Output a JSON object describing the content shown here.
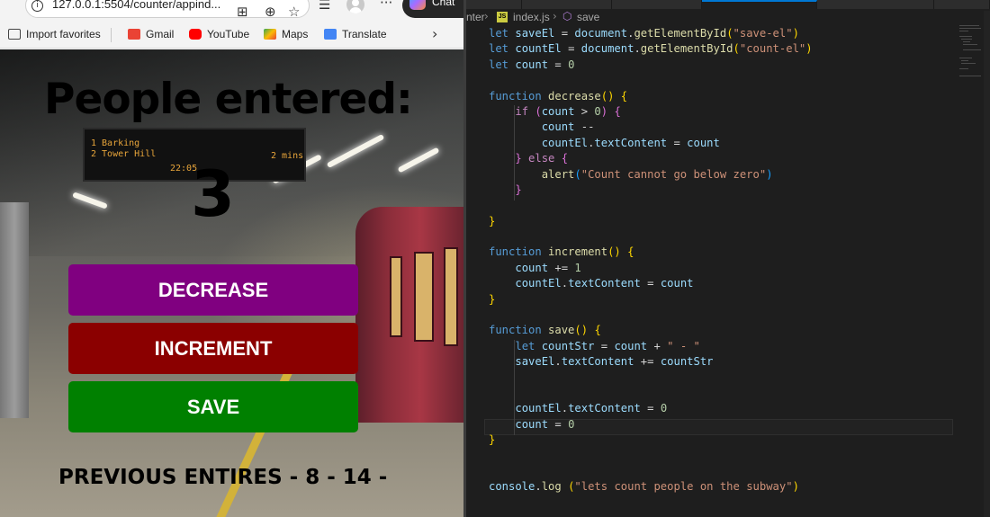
{
  "browser": {
    "url": "127.0.0.1:5504/counter/appind...",
    "copilot_label": "Chat",
    "favorites": [
      {
        "label": "Import favorites",
        "icon": "import-favorites-icon",
        "color": "#444444"
      },
      {
        "label": "Gmail",
        "icon": "gmail-icon",
        "color": "#ea4335"
      },
      {
        "label": "YouTube",
        "icon": "youtube-icon",
        "color": "#ff0000"
      },
      {
        "label": "Maps",
        "icon": "maps-icon",
        "color": "#34a853"
      },
      {
        "label": "Translate",
        "icon": "translate-icon",
        "color": "#4285f4"
      }
    ]
  },
  "app": {
    "heading": "People entered:",
    "count": "3",
    "decrease_label": "DECREASE",
    "increment_label": "INCREMENT",
    "save_label": "SAVE",
    "previous_entries": "PREVIOUS ENTIRES - 8 - 14 -",
    "departure_board": {
      "line1": "1  Barking",
      "line2": "2  Tower Hill",
      "time": "22:05",
      "mins": "2 mins"
    },
    "colors": {
      "decrease": "#800080",
      "increment": "#8b0000",
      "save": "#008000"
    }
  },
  "editor": {
    "breadcrumb": {
      "folder": "nter",
      "file": "index.js",
      "symbol": "save"
    }
  },
  "code_lines": [
    [
      [
        "k",
        "let "
      ],
      [
        "v",
        "saveEl"
      ],
      [
        "p",
        " = "
      ],
      [
        "v",
        "document"
      ],
      [
        "p",
        "."
      ],
      [
        "f",
        "getElementById"
      ],
      [
        "b1",
        "("
      ],
      [
        "s",
        "\"save-el\""
      ],
      [
        "b1",
        ")"
      ]
    ],
    [
      [
        "k",
        "let "
      ],
      [
        "v",
        "countEl"
      ],
      [
        "p",
        " = "
      ],
      [
        "v",
        "document"
      ],
      [
        "p",
        "."
      ],
      [
        "f",
        "getElementById"
      ],
      [
        "b1",
        "("
      ],
      [
        "s",
        "\"count-el\""
      ],
      [
        "b1",
        ")"
      ]
    ],
    [
      [
        "k",
        "let "
      ],
      [
        "v",
        "count"
      ],
      [
        "p",
        " = "
      ],
      [
        "n",
        "0"
      ]
    ],
    [],
    [
      [
        "k",
        "function "
      ],
      [
        "f",
        "decrease"
      ],
      [
        "b1",
        "()"
      ],
      [
        "p",
        " "
      ],
      [
        "b1",
        "{"
      ]
    ],
    [
      [
        "p",
        "    "
      ],
      [
        "kw",
        "if "
      ],
      [
        "b2",
        "("
      ],
      [
        "v",
        "count"
      ],
      [
        "p",
        " > "
      ],
      [
        "n",
        "0"
      ],
      [
        "b2",
        ")"
      ],
      [
        "p",
        " "
      ],
      [
        "b2",
        "{"
      ]
    ],
    [
      [
        "p",
        "        "
      ],
      [
        "v",
        "count"
      ],
      [
        "p",
        " --"
      ]
    ],
    [
      [
        "p",
        "        "
      ],
      [
        "v",
        "countEl"
      ],
      [
        "p",
        "."
      ],
      [
        "v",
        "textContent"
      ],
      [
        "p",
        " = "
      ],
      [
        "v",
        "count"
      ]
    ],
    [
      [
        "p",
        "    "
      ],
      [
        "b2",
        "}"
      ],
      [
        "p",
        " "
      ],
      [
        "kw",
        "else"
      ],
      [
        "p",
        " "
      ],
      [
        "b2",
        "{"
      ]
    ],
    [
      [
        "p",
        "        "
      ],
      [
        "f",
        "alert"
      ],
      [
        "b3",
        "("
      ],
      [
        "s",
        "\"Count cannot go below zero\""
      ],
      [
        "b3",
        ")"
      ]
    ],
    [
      [
        "p",
        "    "
      ],
      [
        "b2",
        "}"
      ]
    ],
    [],
    [
      [
        "b1",
        "}"
      ]
    ],
    [],
    [
      [
        "k",
        "function "
      ],
      [
        "f",
        "increment"
      ],
      [
        "b1",
        "()"
      ],
      [
        "p",
        " "
      ],
      [
        "b1",
        "{"
      ]
    ],
    [
      [
        "p",
        "    "
      ],
      [
        "v",
        "count"
      ],
      [
        "p",
        " += "
      ],
      [
        "n",
        "1"
      ]
    ],
    [
      [
        "p",
        "    "
      ],
      [
        "v",
        "countEl"
      ],
      [
        "p",
        "."
      ],
      [
        "v",
        "textContent"
      ],
      [
        "p",
        " = "
      ],
      [
        "v",
        "count"
      ]
    ],
    [
      [
        "b1",
        "}"
      ]
    ],
    [],
    [
      [
        "k",
        "function "
      ],
      [
        "f",
        "save"
      ],
      [
        "b1",
        "()"
      ],
      [
        "p",
        " "
      ],
      [
        "b1",
        "{"
      ]
    ],
    [
      [
        "p",
        "    "
      ],
      [
        "k",
        "let "
      ],
      [
        "v",
        "countStr"
      ],
      [
        "p",
        " = "
      ],
      [
        "v",
        "count"
      ],
      [
        "p",
        " + "
      ],
      [
        "s",
        "\" - \""
      ]
    ],
    [
      [
        "p",
        "    "
      ],
      [
        "v",
        "saveEl"
      ],
      [
        "p",
        "."
      ],
      [
        "v",
        "textContent"
      ],
      [
        "p",
        " += "
      ],
      [
        "v",
        "countStr"
      ]
    ],
    [],
    [],
    [
      [
        "p",
        "    "
      ],
      [
        "v",
        "countEl"
      ],
      [
        "p",
        "."
      ],
      [
        "v",
        "textContent"
      ],
      [
        "p",
        " = "
      ],
      [
        "n",
        "0"
      ]
    ],
    [
      [
        "p",
        "    "
      ],
      [
        "v",
        "count"
      ],
      [
        "p",
        " = "
      ],
      [
        "n",
        "0"
      ]
    ],
    [
      [
        "b1",
        "}"
      ]
    ],
    [],
    [],
    [
      [
        "v",
        "console"
      ],
      [
        "p",
        "."
      ],
      [
        "f",
        "log"
      ],
      [
        "p",
        " "
      ],
      [
        "b1",
        "("
      ],
      [
        "s",
        "\"lets count people on the subway\""
      ],
      [
        "b1",
        ")"
      ]
    ]
  ]
}
